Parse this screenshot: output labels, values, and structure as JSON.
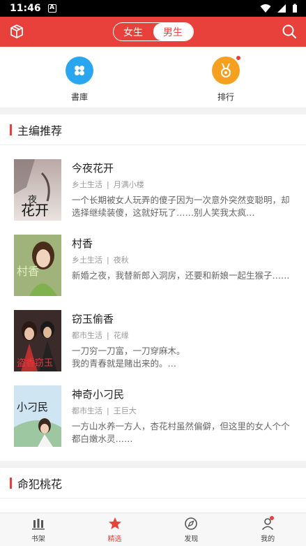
{
  "status_bar": {
    "time": "11:46",
    "a_badge": "A"
  },
  "top_bar": {
    "gender_tabs": [
      {
        "label": "女生",
        "active": false
      },
      {
        "label": "男生",
        "active": true
      }
    ],
    "accent_color": "#e8403a"
  },
  "quick_links": [
    {
      "label": "書庫",
      "icon": "library-icon",
      "color": "#2aa6f0",
      "has_dot": false
    },
    {
      "label": "排行",
      "icon": "medal-icon",
      "color": "#f5a020",
      "has_dot": true
    }
  ],
  "sections": [
    {
      "title": "主编推荐",
      "books": [
        {
          "title": "今夜花开",
          "category": "乡土生活",
          "author": "月满小楼",
          "desc": "一个长期被女人玩弄的傻子因为一次意外突然变聪明，却选择继续装傻，这就好玩了……别人笑我太疯…",
          "cover_text": "今夜花开"
        },
        {
          "title": "村香",
          "category": "乡土生活",
          "author": "夜秋",
          "desc": "新婚之夜，我替新郎入洞房，还要和新娘一起生猴子……",
          "cover_text": "村香"
        },
        {
          "title": "窃玉偷香",
          "category": "都市生活",
          "author": "花缘",
          "desc": "一刀穷一刀富，一刀穿麻木。\n我的青春就是赌出来的。…",
          "cover_text": "盗香窃玉"
        },
        {
          "title": "神奇小刁民",
          "category": "都市生活",
          "author": "王巨大",
          "desc": "一方山水养一方人，杏花村虽然偏僻，但这里的女人个个都白嫩水灵……",
          "cover_text": "小刁民"
        }
      ]
    },
    {
      "title": "命犯桃花",
      "books": []
    }
  ],
  "tab_bar": [
    {
      "label": "书架",
      "icon": "bookshelf-icon",
      "active": false
    },
    {
      "label": "精选",
      "icon": "featured-star-icon",
      "active": true
    },
    {
      "label": "发现",
      "icon": "compass-icon",
      "active": false
    },
    {
      "label": "我的",
      "icon": "profile-icon",
      "active": false,
      "has_dot": true
    }
  ]
}
